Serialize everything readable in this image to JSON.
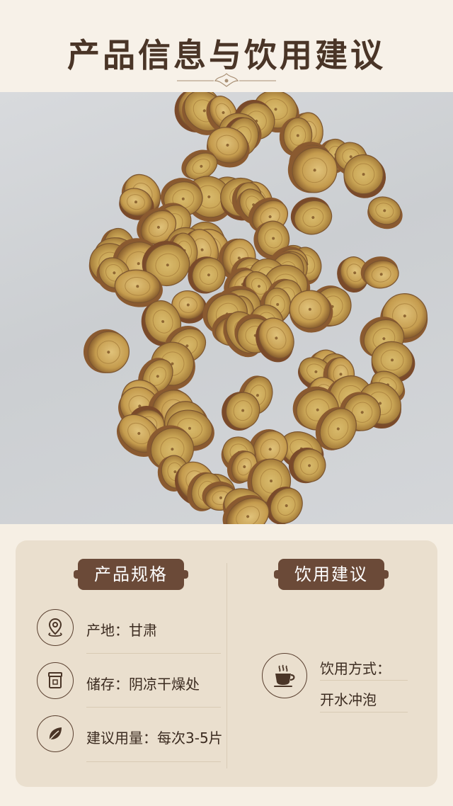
{
  "header": {
    "title": "产品信息与饮用建议"
  },
  "specs": {
    "badge": "产品规格",
    "items": [
      {
        "icon": "location-pin-icon",
        "label": "产地：",
        "value": "甘肃"
      },
      {
        "icon": "storage-jar-icon",
        "label": "储存：",
        "value": "阴凉干燥处"
      },
      {
        "icon": "leaf-icon",
        "label": "建议用量：",
        "value": "每次3-5片"
      }
    ]
  },
  "drink": {
    "badge": "饮用建议",
    "icon": "hot-cup-icon",
    "label": "饮用方式：",
    "value": "开水冲泡"
  },
  "colors": {
    "badge": "#6b4a38",
    "card": "#eadfce",
    "background": "#f6efe4",
    "photo_bg": "#d2d4d7"
  }
}
